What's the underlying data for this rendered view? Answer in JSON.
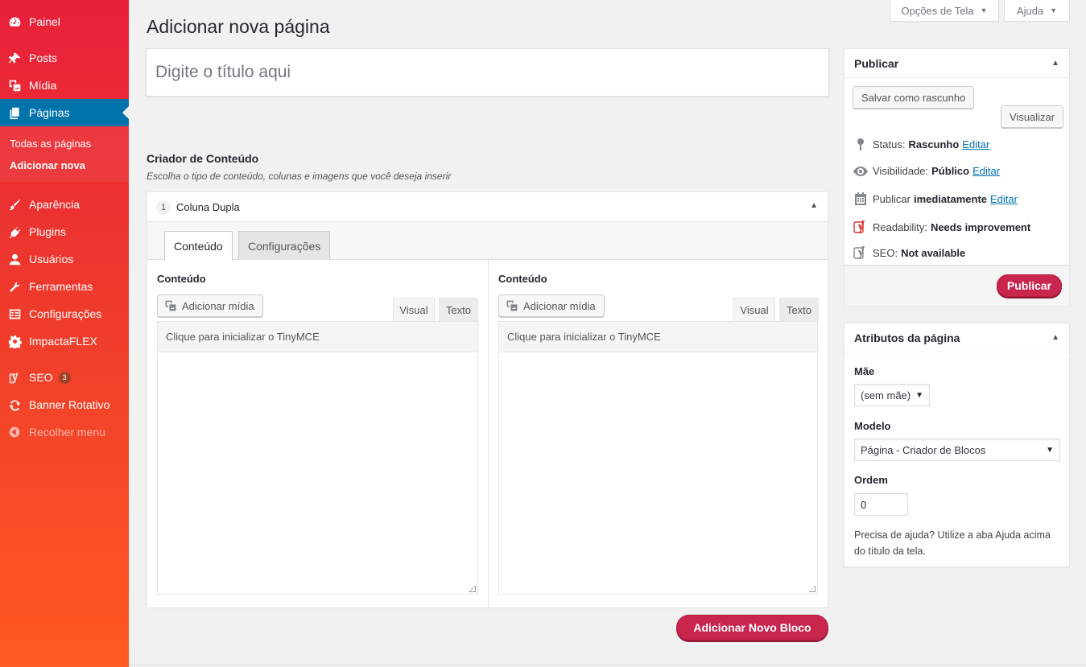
{
  "sidebar": {
    "items": [
      {
        "label": "Painel",
        "icon": "dashboard-icon"
      },
      {
        "label": "Posts",
        "icon": "pin-icon"
      },
      {
        "label": "Mídia",
        "icon": "media-icon"
      },
      {
        "label": "Páginas",
        "icon": "pages-icon"
      },
      {
        "label": "Aparência",
        "icon": "brush-icon"
      },
      {
        "label": "Plugins",
        "icon": "plugin-icon"
      },
      {
        "label": "Usuários",
        "icon": "user-icon"
      },
      {
        "label": "Ferramentas",
        "icon": "wrench-icon"
      },
      {
        "label": "Configurações",
        "icon": "settings-icon"
      },
      {
        "label": "ImpactaFLEX",
        "icon": "gear-icon"
      },
      {
        "label": "SEO",
        "icon": "yoast-icon",
        "badge": "3"
      },
      {
        "label": "Banner Rotativo",
        "icon": "refresh-icon"
      },
      {
        "label": "Recolher menu",
        "icon": "collapse-icon"
      }
    ],
    "submenu": [
      "Todas as páginas",
      "Adicionar nova"
    ]
  },
  "header": {
    "screen_options": "Opções de Tela",
    "help": "Ajuda",
    "title": "Adicionar nova página",
    "title_placeholder": "Digite o título aqui"
  },
  "builder": {
    "title": "Criador de Conteúdo",
    "description": "Escolha o tipo de conteúdo, colunas e imagens que você deseja inserir",
    "block": {
      "number": "1",
      "name": "Coluna Dupla",
      "tabs": [
        "Conteúdo",
        "Configurações"
      ],
      "columns": [
        {
          "label": "Conteúdo",
          "media_button": "Adicionar mídia",
          "tab_visual": "Visual",
          "tab_text": "Texto",
          "tinymce": "Clique para inicializar o TinyMCE"
        },
        {
          "label": "Conteúdo",
          "media_button": "Adicionar mídia",
          "tab_visual": "Visual",
          "tab_text": "Texto",
          "tinymce": "Clique para inicializar o TinyMCE"
        }
      ]
    },
    "add_block_button": "Adicionar Novo Bloco"
  },
  "publish": {
    "title": "Publicar",
    "save_draft": "Salvar como rascunho",
    "preview": "Visualizar",
    "status_label": "Status:",
    "status_value": "Rascunho",
    "visibility_label": "Visibilidade:",
    "visibility_value": "Público",
    "publish_label": "Publicar",
    "publish_value": "imediatamente",
    "edit": "Editar",
    "readability_label": "Readability:",
    "readability_value": "Needs improvement",
    "seo_label": "SEO:",
    "seo_value": "Not available",
    "publish_button": "Publicar"
  },
  "attributes": {
    "title": "Atributos da página",
    "parent_label": "Mãe",
    "parent_value": "(sem mãe)",
    "template_label": "Modelo",
    "template_value": "Página - Criador de Blocos",
    "order_label": "Ordem",
    "order_value": "0",
    "help_text": "Precisa de ajuda? Utilize a aba Ajuda acima do título da tela."
  },
  "colors": {
    "accent": "#c9264e",
    "active_menu": "#0073aa",
    "link": "#0073aa"
  }
}
